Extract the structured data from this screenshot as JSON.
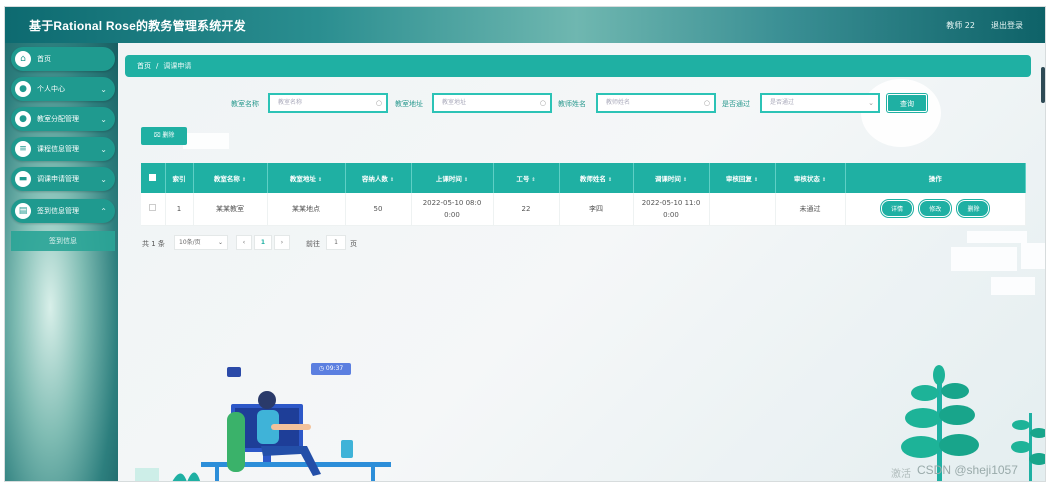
{
  "header": {
    "title": "基于Rational Rose的教务管理系统开发",
    "user": "教师 22",
    "logout": "退出登录"
  },
  "sidebar": {
    "items": [
      {
        "label": "首页",
        "icon": "home-icon"
      },
      {
        "label": "个人中心",
        "icon": "user-icon"
      },
      {
        "label": "教室分配管理",
        "icon": "user-icon"
      },
      {
        "label": "课程信息管理",
        "icon": "list-icon"
      },
      {
        "label": "调课申请管理",
        "icon": "chat-icon"
      },
      {
        "label": "签到信息管理",
        "icon": "clipboard-icon"
      }
    ],
    "sub_item": "签到信息"
  },
  "breadcrumb": {
    "home": "首页",
    "sep": "/",
    "current": "调课申请"
  },
  "search": {
    "fields": [
      {
        "label": "教室名称",
        "placeholder": "教室名称"
      },
      {
        "label": "教室地址",
        "placeholder": "教室地址"
      },
      {
        "label": "教师姓名",
        "placeholder": "教师姓名"
      },
      {
        "label": "是否通过",
        "placeholder": "是否通过"
      }
    ],
    "query_button": "查询"
  },
  "toolbar": {
    "delete_button": "删除"
  },
  "table": {
    "columns": [
      "索引",
      "教室名称",
      "教室地址",
      "容纳人数",
      "上课时间",
      "工号",
      "教师姓名",
      "调课时间",
      "审核回复",
      "审核状态",
      "操作"
    ],
    "rows": [
      {
        "index": "1",
        "room_name": "某某教室",
        "room_address": "某某地点",
        "capacity": "50",
        "class_time": "2022-05-10 08:00:00",
        "job_no": "22",
        "teacher_name": "李四",
        "adjust_time": "2022-05-10 11:00:00",
        "review_reply": "",
        "review_status": "未通过",
        "actions": [
          "详情",
          "修改",
          "删除"
        ]
      }
    ]
  },
  "pagination": {
    "total": "共 1 条",
    "page_size": "10条/页",
    "current_page": "1",
    "goto_label": "前往",
    "goto_value": "1",
    "page_suffix": "页"
  },
  "illustration": {
    "clock": "09:37"
  },
  "overlay": {
    "watermark": "CSDN @sheji1057",
    "activate": "激活"
  },
  "colors": {
    "primary": "#1fb0a3",
    "header_dark": "#0d6a70"
  }
}
